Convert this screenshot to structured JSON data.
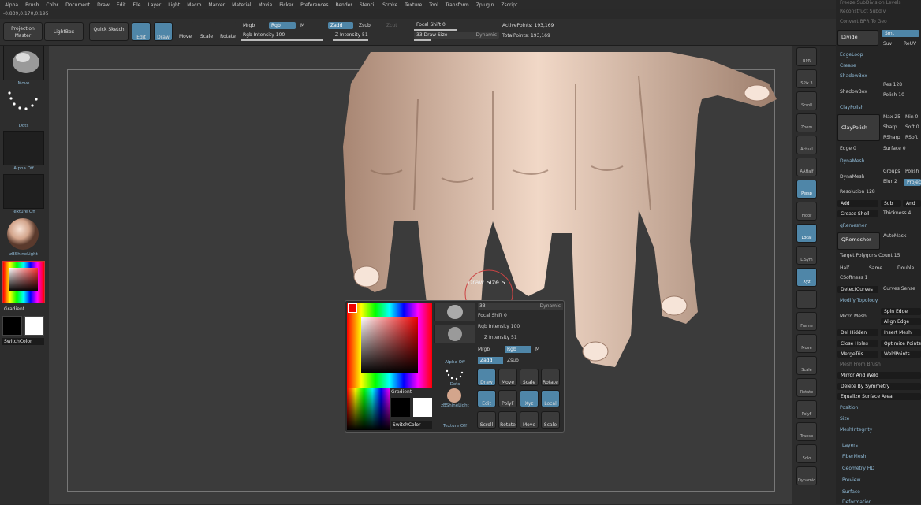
{
  "menu": [
    "Alpha",
    "Brush",
    "Color",
    "Document",
    "Draw",
    "Edit",
    "File",
    "Layer",
    "Light",
    "Macro",
    "Marker",
    "Material",
    "Movie",
    "Picker",
    "Preferences",
    "Render",
    "Stencil",
    "Stroke",
    "Texture",
    "Tool",
    "Transform",
    "Zplugin",
    "Zscript"
  ],
  "coords": "-0.839,0.170,0.195",
  "top": {
    "projection_master": "Projection Master",
    "lightbox": "LightBox",
    "quick_sketch": "Quick Sketch",
    "edit": "Edit",
    "draw": "Draw",
    "move": "Move",
    "scale": "Scale",
    "rotate": "Rotate",
    "mrgb": "Mrgb",
    "rgb": "Rgb",
    "m": "M",
    "zadd": "Zadd",
    "zsub": "Zsub",
    "zcut": "Zcut",
    "rgb_intensity": "Rgb Intensity 100",
    "z_intensity": "Z Intensity 51",
    "focal_shift": "Focal Shift 0",
    "draw_size": "33 Draw Size",
    "dynamic": "Dynamic",
    "active_points": "ActivePoints: 193,169",
    "total_points": "TotalPoints: 193,169"
  },
  "left": {
    "brush": "Move",
    "stroke": "Dots",
    "alpha": "Alpha Off",
    "texture": "Texture Off",
    "material": "zBShineLight",
    "gradient": "Gradient",
    "switch_color": "SwitchColor"
  },
  "right_shelf": [
    "BPR",
    "SPix 3",
    "Scroll",
    "Zoom",
    "Actual",
    "AAHalf",
    "Persp",
    "Floor",
    "Local",
    "L.Sym",
    "Xyz",
    "",
    "Frame",
    "Move",
    "Scale",
    "Rotate",
    "PolyF",
    "Transp",
    "Solo",
    "Dynamic"
  ],
  "panel": {
    "top1": "Freeze SubDivision Levels",
    "top2": "Reconstruct Subdiv",
    "top3": "Convert BPR To Geo",
    "divide": "Divide",
    "smt": "Smt",
    "suv": "Suv",
    "reuv": "ReUV",
    "edgeloop": "EdgeLoop",
    "crease": "Crease",
    "shadowbox_hdr": "ShadowBox",
    "shadowbox": "ShadowBox",
    "res": "Res 128",
    "polish": "Polish 10",
    "claypolish_hdr": "ClayPolish",
    "claypolish": "ClayPolish",
    "max": "Max 25",
    "min": "Min 0",
    "sharp": "Sharp",
    "soft": "Soft 0",
    "rsharp": "RSharp",
    "rsoft": "RSoft",
    "edge": "Edge 0",
    "surface": "Surface 0",
    "dynamesh_hdr": "DynaMesh",
    "dynamesh": "DynaMesh",
    "groups": "Groups",
    "polish2": "Polish",
    "blur": "Blur 2",
    "project": "Project",
    "resolution": "Resolution 128",
    "add": "Add",
    "sub": "Sub",
    "and": "And",
    "create_shell": "Create Shell",
    "thickness": "Thickness 4",
    "qremesher_hdr": "qRemesher",
    "qremesher": "QRemesher",
    "automask": "AutoMask",
    "target": "Target Polygons Count 15",
    "half": "Half",
    "same": "Same",
    "double": "Double",
    "ssoftness": "CSoftness 1",
    "detectcurves": "DetectCurves",
    "curves_sense": "Curves Sense",
    "modify_topology": "Modify Topology",
    "micro_mesh": "Micro Mesh",
    "spin_edge": "Spin Edge",
    "align_edge": "Align Edge",
    "del_hidden": "Del Hidden",
    "insert_mesh": "Insert Mesh",
    "close_holes": "Close Holes",
    "optimize_points": "Optimize Points",
    "mergetris": "MergeTris",
    "weldpoints": "WeldPoints",
    "mesh_from_brush": "Mesh From Brush",
    "mirror_and_weld": "Mirror And Weld",
    "delete_by_symmetry": "Delete By Symmetry",
    "equalize": "Equalize Surface Area",
    "position": "Position",
    "size": "Size",
    "meshintegrity": "MeshIntegrity",
    "layers": "Layers",
    "fibermesh": "FiberMesh",
    "geometry_hd": "Geometry HD",
    "preview": "Preview",
    "surface2": "Surface",
    "deformation": "Deformation"
  },
  "popup": {
    "draw_size": "33",
    "dyn": "Dynamic",
    "focal_shift": "Focal Shift 0",
    "rgb_intensity": "Rgb Intensity 100",
    "z_intensity": "Z Intensity 51",
    "mrgb": "Mrgb",
    "rgb": "Rgb",
    "m": "M",
    "zadd": "Zadd",
    "zsub": "Zsub",
    "alpha_off": "Alpha Off",
    "dots": "Dots",
    "gradient": "Gradient",
    "switch_color": "SwitchColor",
    "texture_off": "Texture Off",
    "material": "zBShineLight",
    "draw": "Draw",
    "move": "Move",
    "scale": "Scale",
    "rotate": "Rotate",
    "edit": "Edit",
    "polyf": "PolyF",
    "xyz": "Xyz",
    "local": "Local",
    "scroll": "Scroll",
    "rotate2": "Rotate",
    "move2": "Move",
    "scale2": "Scale",
    "brush": "Move"
  },
  "tip": "Draw Size S"
}
